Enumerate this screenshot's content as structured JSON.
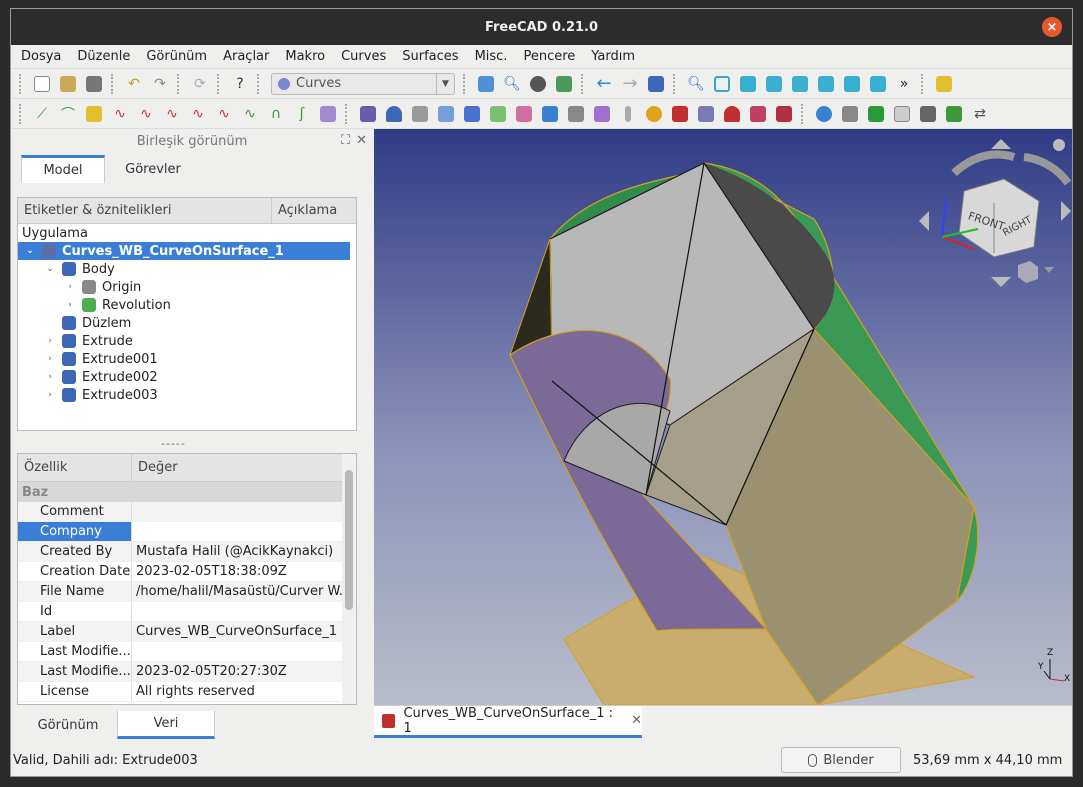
{
  "window": {
    "title": "FreeCAD 0.21.0",
    "close": "×"
  },
  "menu": [
    "Dosya",
    "Düzenle",
    "Görünüm",
    "Araçlar",
    "Makro",
    "Curves",
    "Surfaces",
    "Misc.",
    "Pencere",
    "Yardım"
  ],
  "toolbar": {
    "workbench": "Curves",
    "more": "»"
  },
  "combo_view": {
    "title": "Birleşik görünüm",
    "tabs": [
      "Model",
      "Görevler"
    ],
    "tree_headers": [
      "Etiketler & öznitelikleri",
      "Açıklama"
    ],
    "group_label": "Uygulama",
    "tree": [
      {
        "label": "Curves_WB_CurveOnSurface_1",
        "level": 0,
        "expander": "⌄",
        "icon_color": "#5a6fa8",
        "selected": true
      },
      {
        "label": "Body",
        "level": 1,
        "expander": "⌄",
        "icon_color": "#3f67b8"
      },
      {
        "label": "Origin",
        "level": 2,
        "expander": "›",
        "icon_color": "#888888"
      },
      {
        "label": "Revolution",
        "level": 2,
        "expander": "›",
        "icon_color": "#4caf50"
      },
      {
        "label": "Düzlem",
        "level": 1,
        "expander": "",
        "icon_color": "#3f67b8"
      },
      {
        "label": "Extrude",
        "level": 1,
        "expander": "›",
        "icon_color": "#3f67b8"
      },
      {
        "label": "Extrude001",
        "level": 1,
        "expander": "›",
        "icon_color": "#3f67b8"
      },
      {
        "label": "Extrude002",
        "level": 1,
        "expander": "›",
        "icon_color": "#3f67b8"
      },
      {
        "label": "Extrude003",
        "level": 1,
        "expander": "›",
        "icon_color": "#3f67b8"
      }
    ],
    "splitter": "-----",
    "prop_headers": [
      "Özellik",
      "Değer"
    ],
    "prop_group": "Baz",
    "properties": [
      {
        "key": "Comment",
        "value": ""
      },
      {
        "key": "Company",
        "value": "",
        "selected": true
      },
      {
        "key": "Created By",
        "value": "Mustafa Halil (@AcikKaynakci)"
      },
      {
        "key": "Creation Date",
        "value": "2023-02-05T18:38:09Z"
      },
      {
        "key": "File Name",
        "value": "/home/halil/Masaüstü/Curver W..."
      },
      {
        "key": "Id",
        "value": ""
      },
      {
        "key": "Label",
        "value": "Curves_WB_CurveOnSurface_1"
      },
      {
        "key": "Last Modifie...",
        "value": ""
      },
      {
        "key": "Last Modifie...",
        "value": "2023-02-05T20:27:30Z"
      },
      {
        "key": "License",
        "value": "All rights reserved"
      }
    ],
    "bottom_tabs": [
      "Görünüm",
      "Veri"
    ]
  },
  "navcube": {
    "front": "FRONT",
    "right": "RIGHT"
  },
  "axes": {
    "z": "Z",
    "y": "Y",
    "x": "X"
  },
  "document_tab": {
    "label": "Curves_WB_CurveOnSurface_1 : 1",
    "close": "✕"
  },
  "status": {
    "message": "Valid, Dahili adı: Extrude003",
    "nav_style": "Blender",
    "dimensions": "53,69 mm x 44,10 mm"
  }
}
